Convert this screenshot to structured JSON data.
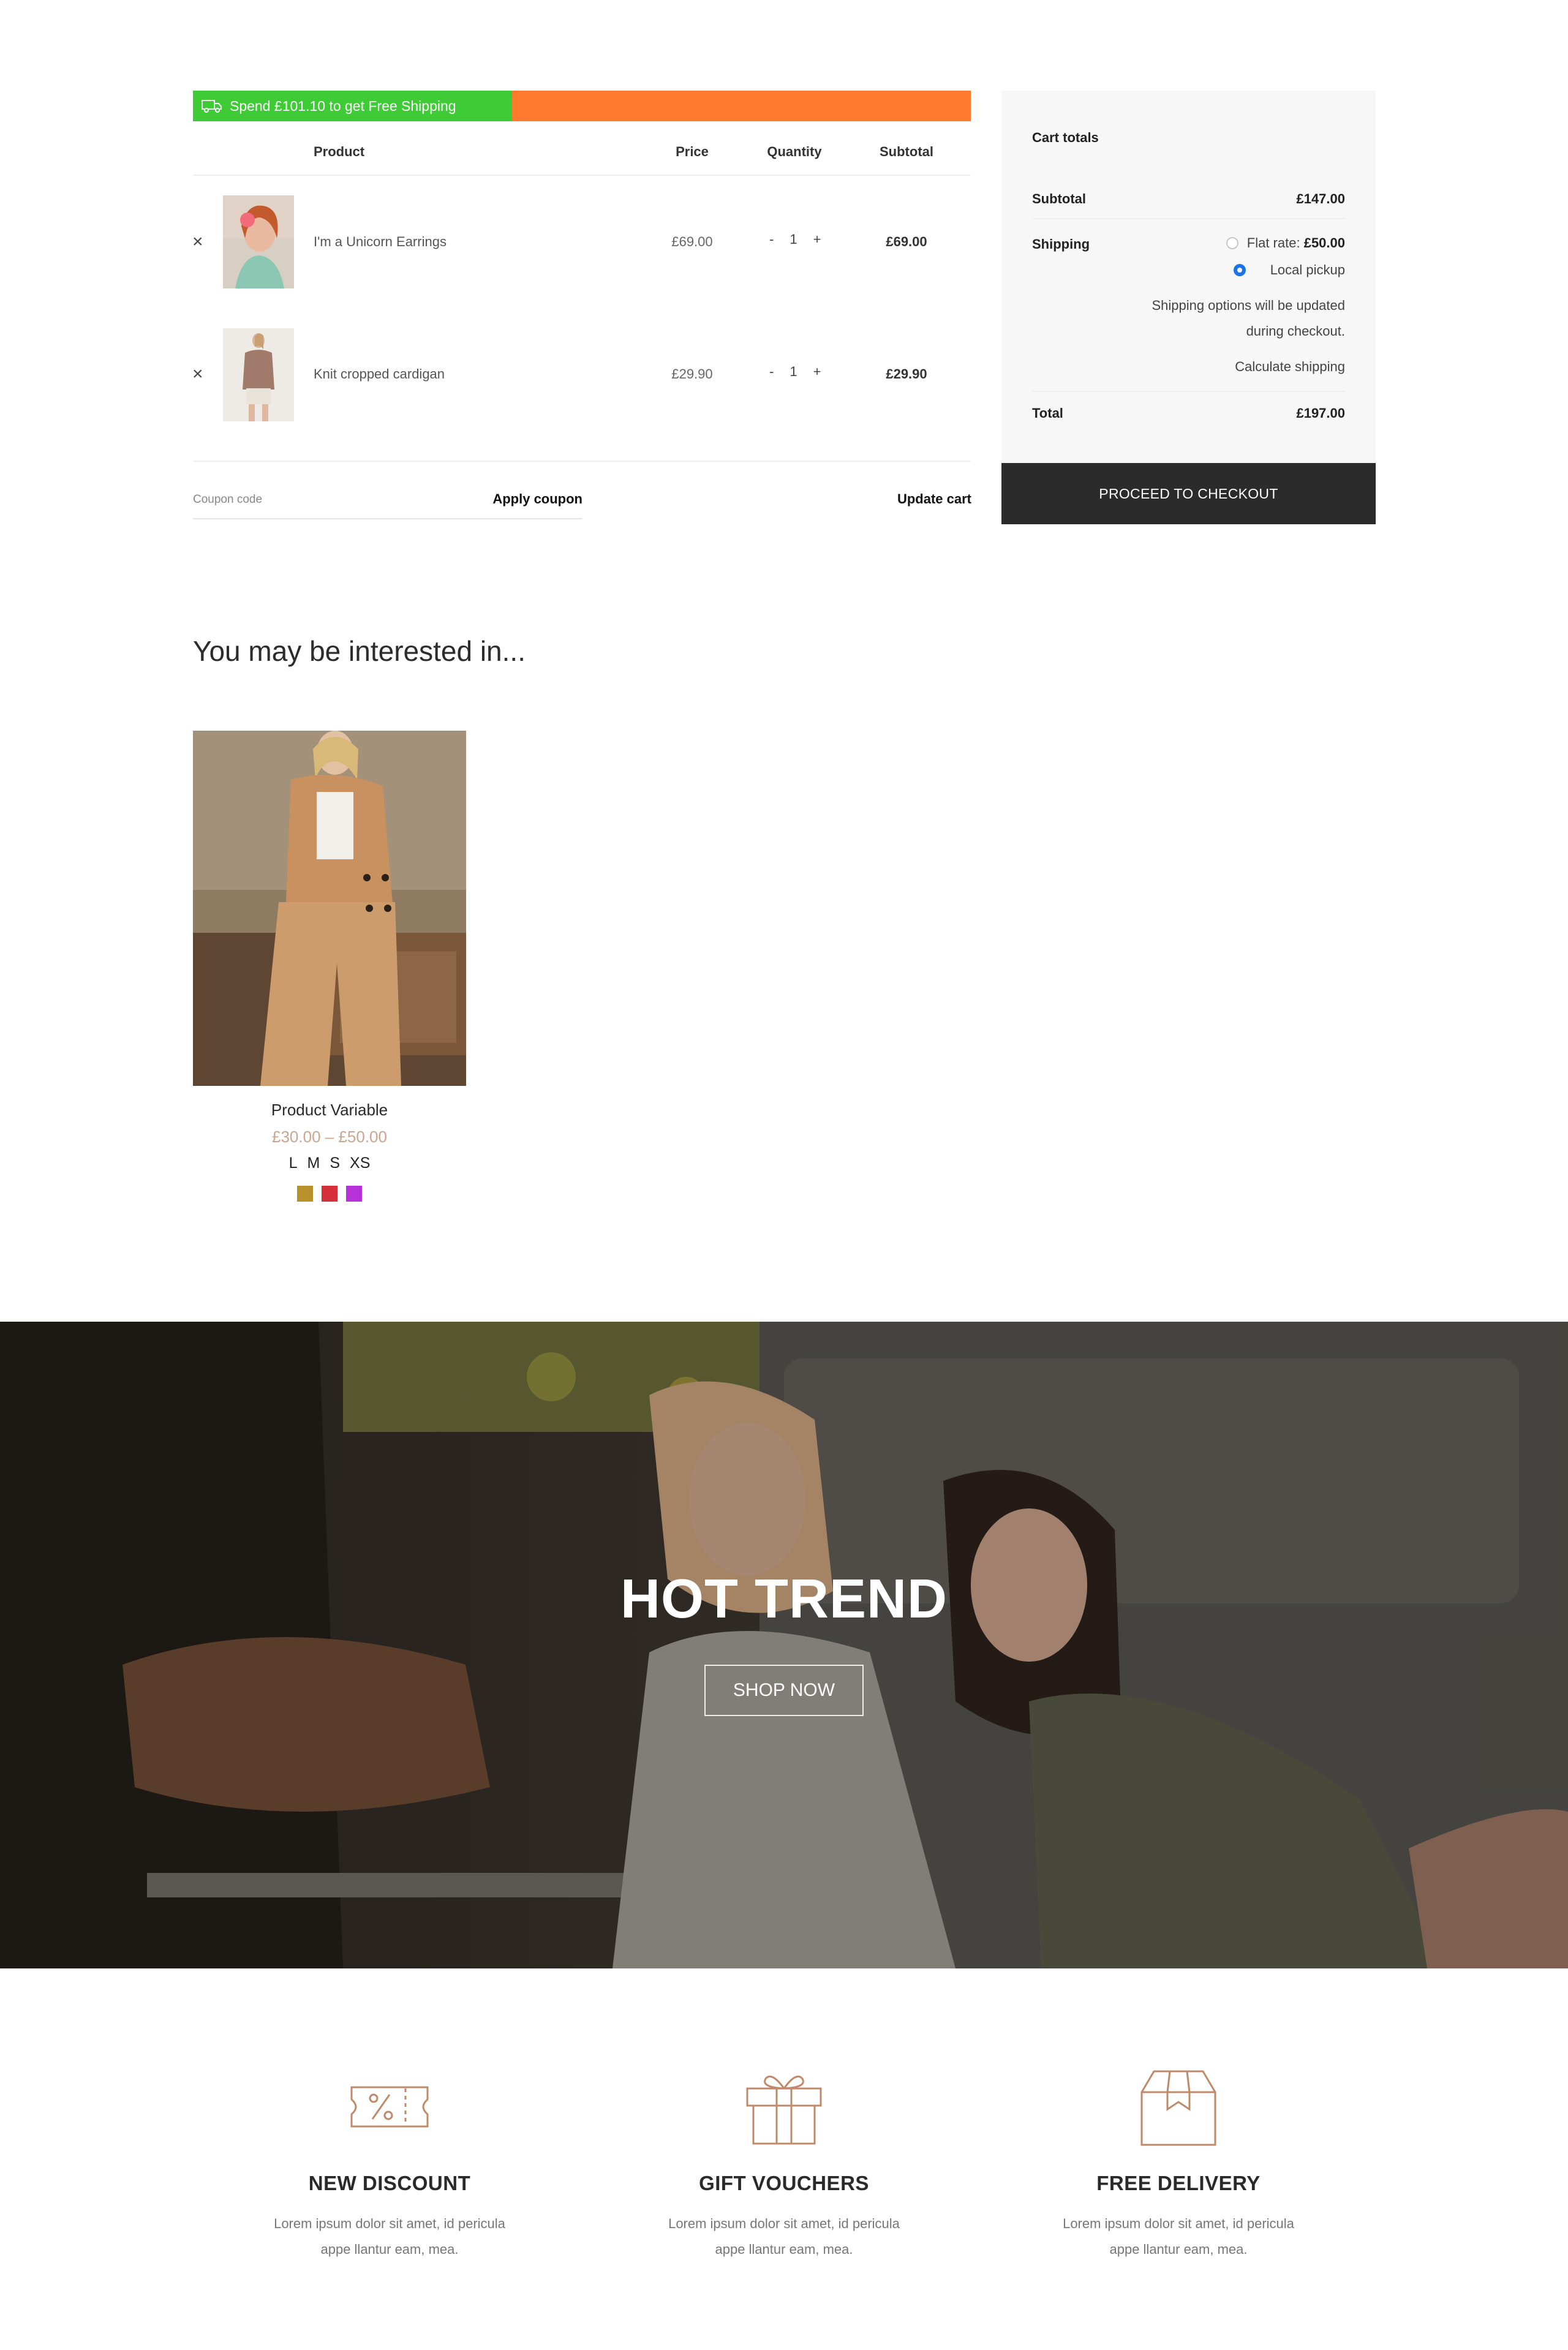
{
  "shipping_bar": {
    "text": "Spend £101.10 to get Free Shipping",
    "progress_fraction": 0.41,
    "fill_color": "#3ecb35",
    "track_color": "#ff7a2f",
    "icon": "truck-icon"
  },
  "cart_table": {
    "headers": {
      "product": "Product",
      "price": "Price",
      "quantity": "Quantity",
      "subtotal": "Subtotal"
    },
    "rows": [
      {
        "name": "I'm a Unicorn Earrings",
        "price": "£69.00",
        "qty": "1",
        "subtotal": "£69.00"
      },
      {
        "name": "Knit cropped cardigan",
        "price": "£29.90",
        "qty": "1",
        "subtotal": "£29.90"
      }
    ],
    "remove_symbol": "×",
    "qty_minus": "-",
    "qty_plus": "+"
  },
  "coupon": {
    "placeholder": "Coupon code",
    "apply_label": "Apply coupon",
    "update_label": "Update cart"
  },
  "totals": {
    "title": "Cart totals",
    "subtotal_label": "Subtotal",
    "subtotal_value": "£147.00",
    "shipping_label": "Shipping",
    "flat_rate_label": "Flat rate:",
    "flat_rate_value": "£50.00",
    "local_pickup_label": "Local pickup",
    "note_line1": "Shipping options will be updated",
    "note_line2": "during checkout.",
    "calculate_label": "Calculate shipping",
    "total_label": "Total",
    "total_value": "£197.00",
    "checkout_label": "PROCEED TO CHECKOUT",
    "selected_option": "Local pickup"
  },
  "recommendations": {
    "heading": "You may be interested in...",
    "product": {
      "name": "Product Variable",
      "price": "£30.00 – £50.00",
      "sizes": [
        "L",
        "M",
        "S",
        "XS"
      ],
      "swatch_colors": [
        "#b8902c",
        "#d6303a",
        "#b632d8"
      ]
    }
  },
  "hero": {
    "title": "HOT TREND",
    "button_label": "SHOP NOW"
  },
  "features": [
    {
      "icon": "discount-ticket-icon",
      "title": "NEW DISCOUNT",
      "line1": "Lorem ipsum dolor sit amet, id pericula",
      "line2": "appe llantur eam, mea."
    },
    {
      "icon": "gift-icon",
      "title": "GIFT VOUCHERS",
      "line1": "Lorem ipsum dolor sit amet, id pericula",
      "line2": "appe llantur eam, mea."
    },
    {
      "icon": "delivery-box-icon",
      "title": "FREE DELIVERY",
      "line1": "Lorem ipsum dolor sit amet, id pericula",
      "line2": "appe llantur eam, mea."
    }
  ],
  "accent_color": "#c08a6a"
}
